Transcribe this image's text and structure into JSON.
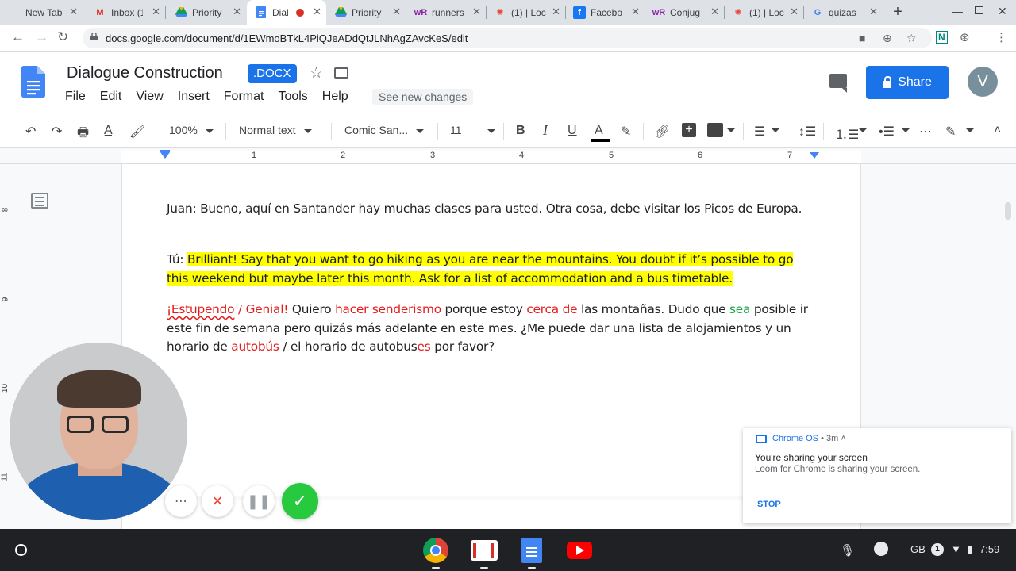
{
  "browser": {
    "tabs": [
      {
        "title": "New Tab",
        "favicon": "blank"
      },
      {
        "title": "Inbox (1",
        "favicon": "gmail"
      },
      {
        "title": "Priority",
        "favicon": "drive"
      },
      {
        "title": "Dial",
        "favicon": "docs"
      },
      {
        "title": "Priority",
        "favicon": "drive"
      },
      {
        "title": "runners",
        "favicon": "wordreference"
      },
      {
        "title": "(1) | Loc",
        "favicon": "loom"
      },
      {
        "title": "Facebo",
        "favicon": "facebook"
      },
      {
        "title": "Conjug",
        "favicon": "wordreference"
      },
      {
        "title": "(1) | Loc",
        "favicon": "loom"
      },
      {
        "title": "quizas",
        "favicon": "google"
      }
    ],
    "url": "docs.google.com/document/d/1EWmoBTkL4PiQJeADdQtJLNhAgZAvcKeS/edit"
  },
  "doc": {
    "title": "Dialogue Construction",
    "badge": ".DOCX",
    "menu": [
      "File",
      "Edit",
      "View",
      "Insert",
      "Format",
      "Tools",
      "Help"
    ],
    "see_changes": "See new changes",
    "share_label": "Share",
    "avatar_initial": "V"
  },
  "toolbar": {
    "zoom": "100%",
    "style": "Normal text",
    "font": "Comic San...",
    "size": "11"
  },
  "ruler": {
    "h_numbers": [
      "1",
      "2",
      "3",
      "4",
      "5",
      "6",
      "7"
    ],
    "v_numbers": [
      "8",
      "9",
      "10",
      "11"
    ]
  },
  "content": {
    "p1": "Juan: Bueno, aquí en Santander hay muchas clases para usted. Otra cosa, debe visitar los Picos de Europa.",
    "p2_prefix": "Tú: ",
    "p2_highlight": "Brilliant! Say that you want to go hiking as you are near the mountains. You doubt if it’s possible to go this weekend but maybe later this month. Ask for a list of accommodation and a bus timetable.",
    "p3": [
      {
        "text": "¡Estupendo",
        "style": "red-wavy"
      },
      {
        "text": " / Genial!",
        "style": "red"
      },
      {
        "text": " Quiero ",
        "style": "normal"
      },
      {
        "text": "hacer senderismo",
        "style": "red"
      },
      {
        "text": " porque estoy ",
        "style": "normal"
      },
      {
        "text": "cerca de",
        "style": "red"
      },
      {
        "text": " las montañas. Dudo que ",
        "style": "normal"
      },
      {
        "text": "sea",
        "style": "green"
      },
      {
        "text": " posible ir este fin de semana pero quizás más adelante en este mes. ¿Me puede dar una lista de alojamientos y un horario de ",
        "style": "normal"
      },
      {
        "text": "autobús",
        "style": "red"
      },
      {
        "text": " / el horario de autobus",
        "style": "normal"
      },
      {
        "text": "es",
        "style": "red"
      },
      {
        "text": " por favor?",
        "style": "normal"
      }
    ]
  },
  "notification": {
    "source": "Chrome OS",
    "time": "• 3m ˄",
    "title": "You're sharing your screen",
    "body": "Loom for Chrome is sharing your screen.",
    "action": "STOP"
  },
  "shelf": {
    "region": "GB",
    "badge": "1",
    "time": "7:59"
  },
  "colors": {
    "accent": "#1a73e8",
    "highlight": "#ffff00",
    "error_red": "#e31b1b",
    "correct_green": "#1ea64b"
  }
}
